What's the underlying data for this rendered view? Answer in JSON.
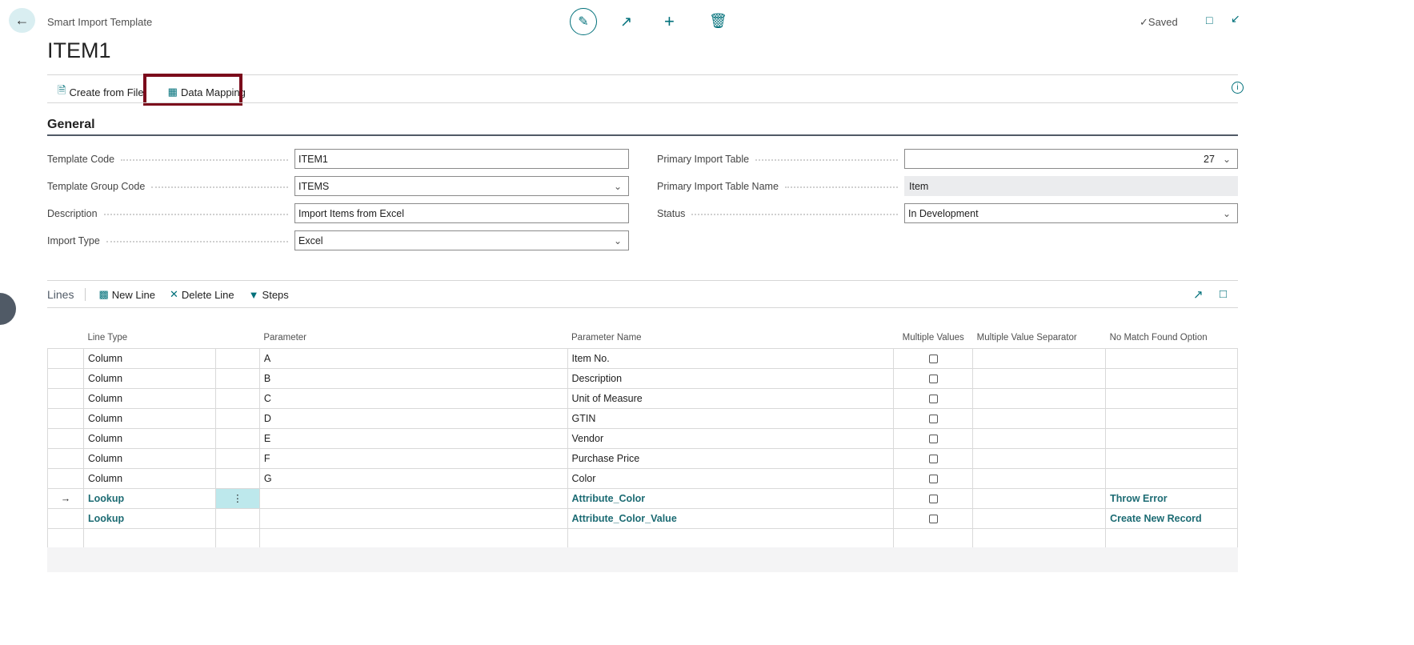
{
  "header": {
    "breadcrumb": "Smart Import Template",
    "title": "ITEM1",
    "status": "Saved"
  },
  "actions": {
    "create_from_file": "Create from File",
    "data_mapping": "Data Mapping"
  },
  "general": {
    "heading": "General",
    "fields_left": [
      {
        "label": "Template Code",
        "value": "ITEM1",
        "type": "text"
      },
      {
        "label": "Template Group Code",
        "value": "ITEMS",
        "type": "select"
      },
      {
        "label": "Description",
        "value": "Import Items from Excel",
        "type": "text"
      },
      {
        "label": "Import Type",
        "value": "Excel",
        "type": "select"
      }
    ],
    "fields_right": [
      {
        "label": "Primary Import Table",
        "value": "27",
        "type": "select"
      },
      {
        "label": "Primary Import Table Name",
        "value": "Item",
        "type": "readonly"
      },
      {
        "label": "Status",
        "value": "In Development",
        "type": "select"
      }
    ]
  },
  "lines": {
    "heading": "Lines",
    "new_line": "New Line",
    "delete_line": "Delete Line",
    "steps": "Steps",
    "columns": [
      "Line Type",
      "",
      "Parameter",
      "Parameter Name",
      "Multiple Values",
      "Multiple Value Separator",
      "No Match Found Option"
    ],
    "rows": [
      {
        "type": "Column",
        "param": "A",
        "name": "Item No.",
        "multi": false,
        "sep": "",
        "nomatch": ""
      },
      {
        "type": "Column",
        "param": "B",
        "name": "Description",
        "multi": false,
        "sep": "",
        "nomatch": ""
      },
      {
        "type": "Column",
        "param": "C",
        "name": "Unit of Measure",
        "multi": false,
        "sep": "",
        "nomatch": ""
      },
      {
        "type": "Column",
        "param": "D",
        "name": "GTIN",
        "multi": false,
        "sep": "",
        "nomatch": ""
      },
      {
        "type": "Column",
        "param": "E",
        "name": "Vendor",
        "multi": false,
        "sep": "",
        "nomatch": ""
      },
      {
        "type": "Column",
        "param": "F",
        "name": "Purchase Price",
        "multi": false,
        "sep": "",
        "nomatch": ""
      },
      {
        "type": "Column",
        "param": "G",
        "name": "Color",
        "multi": false,
        "sep": "",
        "nomatch": ""
      },
      {
        "type": "Lookup",
        "param": "",
        "name": "Attribute_Color",
        "multi": false,
        "sep": "",
        "nomatch": "Throw Error",
        "current": true
      },
      {
        "type": "Lookup",
        "param": "",
        "name": "Attribute_Color_Value",
        "multi": false,
        "sep": "",
        "nomatch": "Create New Record"
      }
    ]
  }
}
